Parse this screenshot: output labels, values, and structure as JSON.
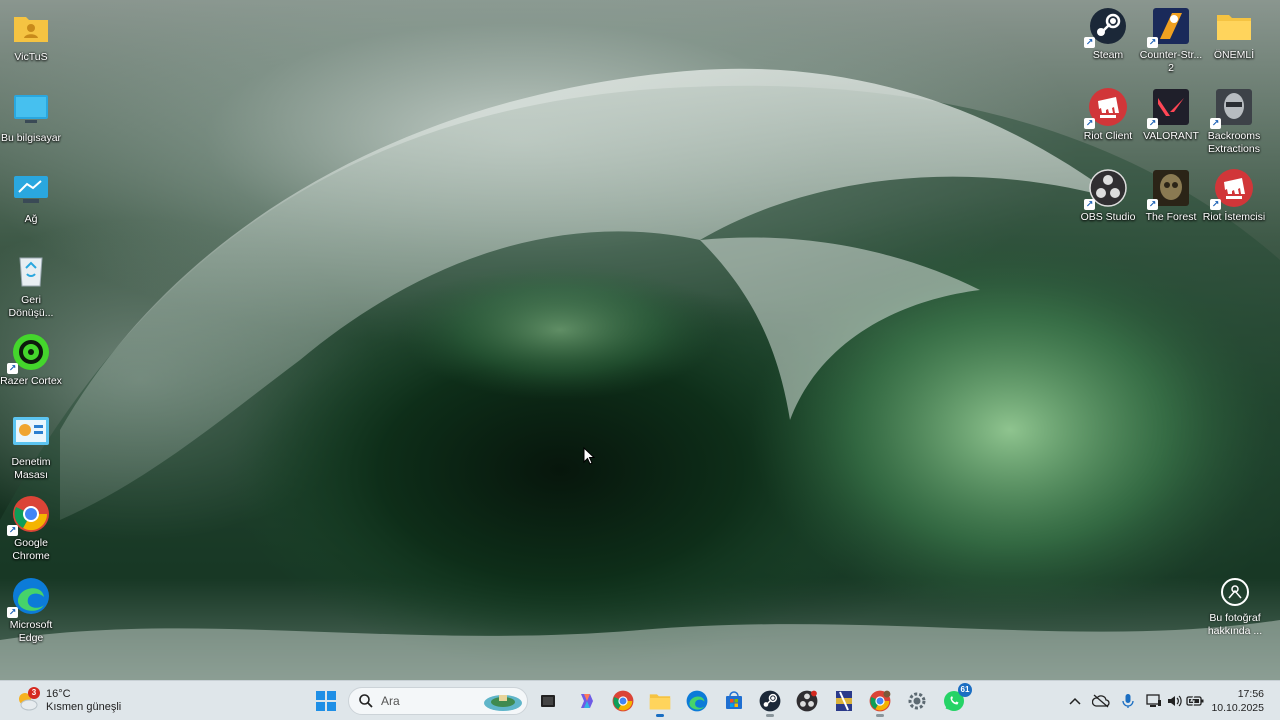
{
  "desktop": {
    "left_icons": [
      {
        "label": "VicTuS",
        "icon": "user-folder-icon"
      },
      {
        "label": "Bu bilgisayar",
        "icon": "computer-icon"
      },
      {
        "label": "Ağ",
        "icon": "network-icon"
      },
      {
        "label": "Geri Dönüşü...",
        "icon": "recycle-bin-icon"
      },
      {
        "label": "Razer Cortex",
        "icon": "razer-cortex-icon"
      },
      {
        "label": "Denetim Masası",
        "icon": "control-panel-icon"
      },
      {
        "label": "Google Chrome",
        "icon": "chrome-icon"
      },
      {
        "label": "Microsoft Edge",
        "icon": "edge-icon"
      }
    ],
    "right_icons": [
      {
        "label": "Steam",
        "icon": "steam-icon"
      },
      {
        "label": "Counter-Str... 2",
        "icon": "counter-strike-icon"
      },
      {
        "label": "ÖNEMLİ",
        "icon": "folder-icon"
      },
      {
        "label": "Riot Client",
        "icon": "riot-client-icon"
      },
      {
        "label": "VALORANT",
        "icon": "valorant-icon"
      },
      {
        "label": "Backrooms Extractions",
        "icon": "backrooms-icon"
      },
      {
        "label": "OBS Studio",
        "icon": "obs-icon"
      },
      {
        "label": "The Forest",
        "icon": "the-forest-icon"
      },
      {
        "label": "Riot İstemcisi",
        "icon": "riot-client-icon"
      }
    ],
    "about_photo": {
      "label": "Bu fotoğraf hakkında ...",
      "icon": "camera-info-icon"
    }
  },
  "taskbar": {
    "weather": {
      "temp": "16°C",
      "condition": "Kısmen güneşli",
      "badge": "3"
    },
    "search_placeholder": "Ara",
    "apps": [
      {
        "name": "start-button",
        "icon": "windows-logo-icon"
      },
      {
        "name": "widgets",
        "icon": "widget-landscape-icon"
      },
      {
        "name": "task-view",
        "icon": "task-view-icon"
      },
      {
        "name": "copilot",
        "icon": "copilot-icon"
      },
      {
        "name": "chrome",
        "icon": "chrome-icon"
      },
      {
        "name": "file-explorer",
        "icon": "folder-icon"
      },
      {
        "name": "edge",
        "icon": "edge-icon"
      },
      {
        "name": "microsoft-store",
        "icon": "store-icon"
      },
      {
        "name": "steam",
        "icon": "steam-icon"
      },
      {
        "name": "obs",
        "icon": "obs-icon"
      },
      {
        "name": "winrar",
        "icon": "winrar-icon"
      },
      {
        "name": "chrome-profile",
        "icon": "chrome-icon"
      },
      {
        "name": "settings",
        "icon": "gear-icon"
      },
      {
        "name": "whatsapp",
        "icon": "whatsapp-icon"
      }
    ],
    "whatsapp_badge": "61",
    "tray": {
      "time": "17:56",
      "date": "10.10.2025"
    }
  },
  "colors": {
    "taskbar_bg": "#dfe6ea",
    "accent_blue": "#1b6ec2",
    "riot_red": "#d13639",
    "valorant_red": "#ff4655"
  }
}
